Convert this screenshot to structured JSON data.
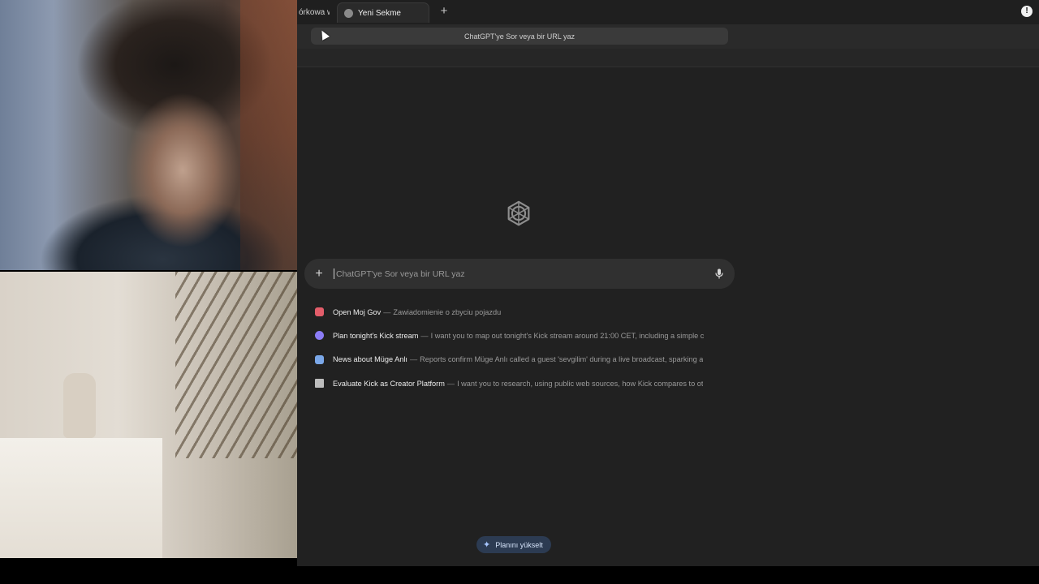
{
  "browser": {
    "tabs": [
      {
        "label": "órkowa w",
        "active": false
      },
      {
        "label": "Yeni Sekme",
        "active": true
      }
    ],
    "omnibox_placeholder": "ChatGPT'ye Sor veya bir URL yaz"
  },
  "ntp": {
    "search_placeholder": "ChatGPT'ye Sor veya bir URL yaz",
    "suggestions": [
      {
        "icon": "flag-icon",
        "color": "#e35d6a",
        "title": "Open Moj Gov",
        "separator": "—",
        "description": "Zawiadomienie o zbyciu pojazdu"
      },
      {
        "icon": "chat-bubble-icon",
        "color": "#8b7cf6",
        "title": "Plan tonight's Kick stream",
        "separator": "—",
        "description": "I want you to map out tonight's Kick stream around 21:00 CET, including a simple c"
      },
      {
        "icon": "document-icon",
        "color": "#7aa7e8",
        "title": "News about Müge Anlı",
        "separator": "—",
        "description": "Reports confirm Müge Anlı called a guest 'sevgilim' during a live broadcast, sparking a"
      },
      {
        "icon": "telescope-icon",
        "color": "#bdbdbd",
        "title": "Evaluate Kick as Creator Platform",
        "separator": "—",
        "description": "I want you to research, using public web sources, how Kick compares to ot"
      }
    ],
    "upgrade_label": "Planını yükselt"
  },
  "colors": {
    "background": "#212121",
    "searchbar": "#303030",
    "upgrade_pill": "#2c3b52"
  }
}
